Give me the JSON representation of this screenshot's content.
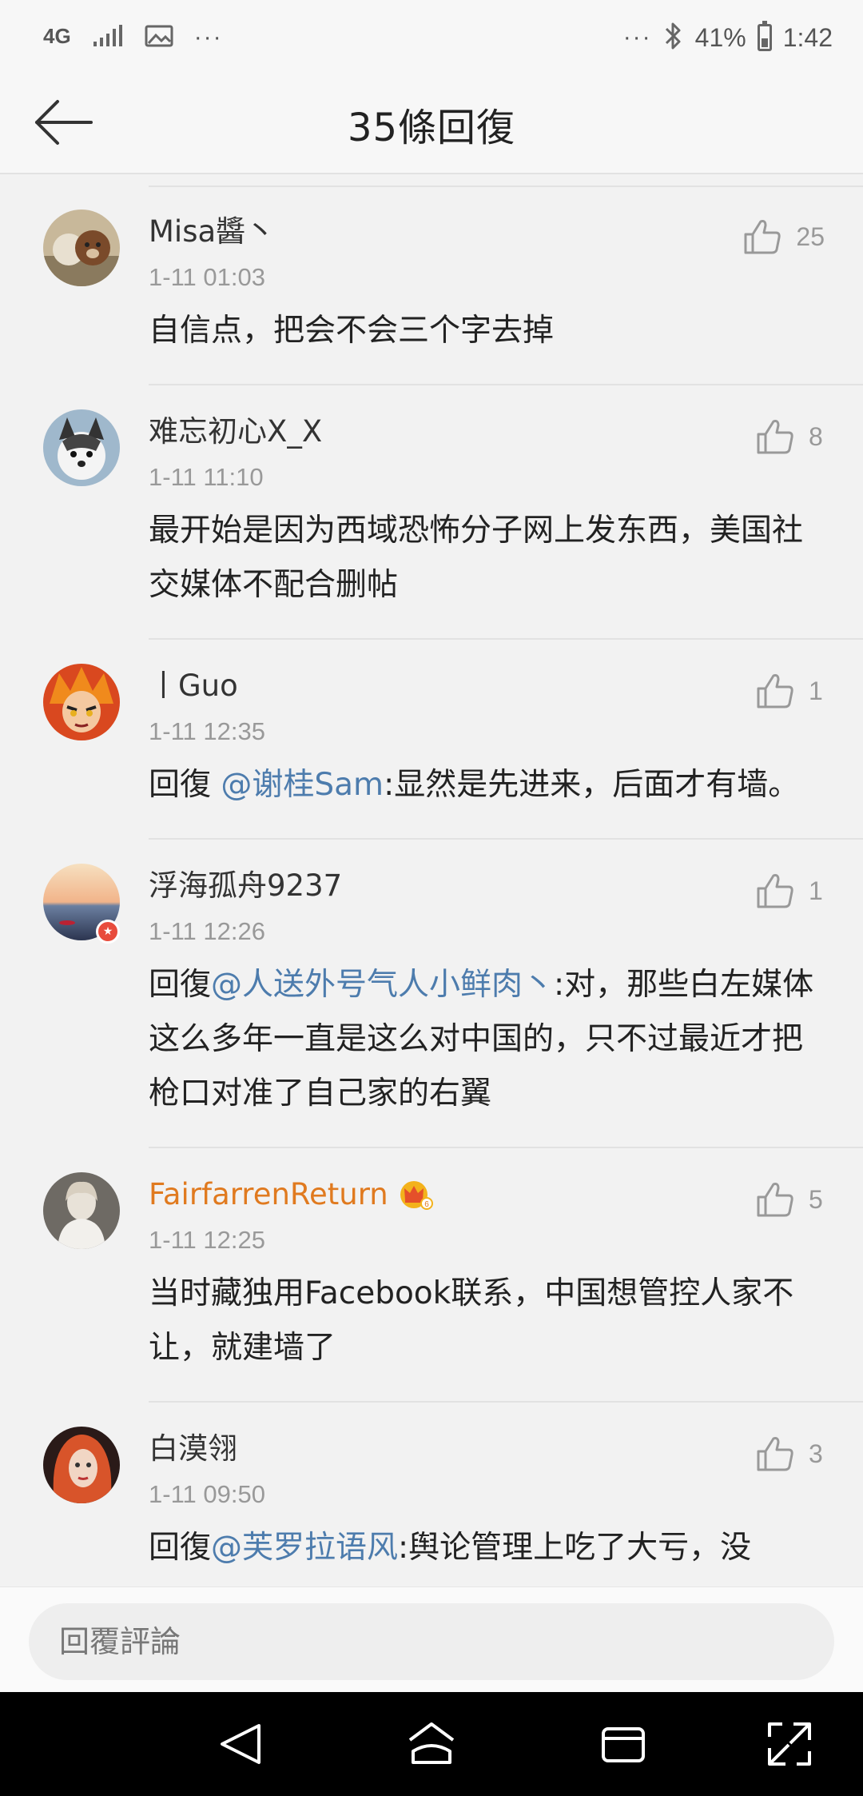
{
  "status_bar": {
    "network": "4G",
    "battery_text": "41%",
    "battery_level": 0.41,
    "time": "1:42",
    "more_dots": "···"
  },
  "header": {
    "title": "35條回復"
  },
  "comments": [
    {
      "name": "Misa醬丶",
      "time": "1-11 01:03",
      "text": "自信点，把会不会三个字去掉",
      "mention": "",
      "prefix": "",
      "likes": "25"
    },
    {
      "name": "难忘初心X_X",
      "time": "1-11 11:10",
      "text": "最开始是因为西域恐怖分子网上发东西，美国社交媒体不配合删帖",
      "mention": "",
      "prefix": "",
      "likes": "8"
    },
    {
      "name": "丨Guo",
      "time": "1-11 12:35",
      "prefix": "回復 ",
      "mention": "@谢桂Sam",
      "text": ":显然是先进来，后面才有墙。",
      "likes": "1"
    },
    {
      "name": "浮海孤舟9237",
      "time": "1-11 12:26",
      "prefix": "回復",
      "mention": "@人送外号气人小鲜肉丶",
      "text": ":对，那些白左媒体这么多年一直是这么对中国的，只不过最近才把枪口对准了自己家的右翼",
      "likes": "1"
    },
    {
      "name": "FairfarrenReturn",
      "time": "1-11 12:25",
      "text": "当时藏独用Facebook联系，中国想管控人家不让，就建墙了",
      "mention": "",
      "prefix": "",
      "likes": "5"
    },
    {
      "name": "白漠翎",
      "time": "1-11 09:50",
      "prefix": "回復",
      "mention": "@芙罗拉语风",
      "text": ":舆论管理上吃了大亏，没",
      "likes": "3"
    }
  ],
  "reply_bar": {
    "placeholder": "回覆評論"
  },
  "colors": {
    "mention": "#4d7cad",
    "vip_name": "#e07a1f",
    "background": "#f2f2f2"
  },
  "icons": [
    "back-arrow-icon",
    "thumbs-up-icon",
    "crown-icon",
    "nav-back-icon",
    "nav-home-icon",
    "nav-recents-icon",
    "nav-rotate-icon"
  ]
}
